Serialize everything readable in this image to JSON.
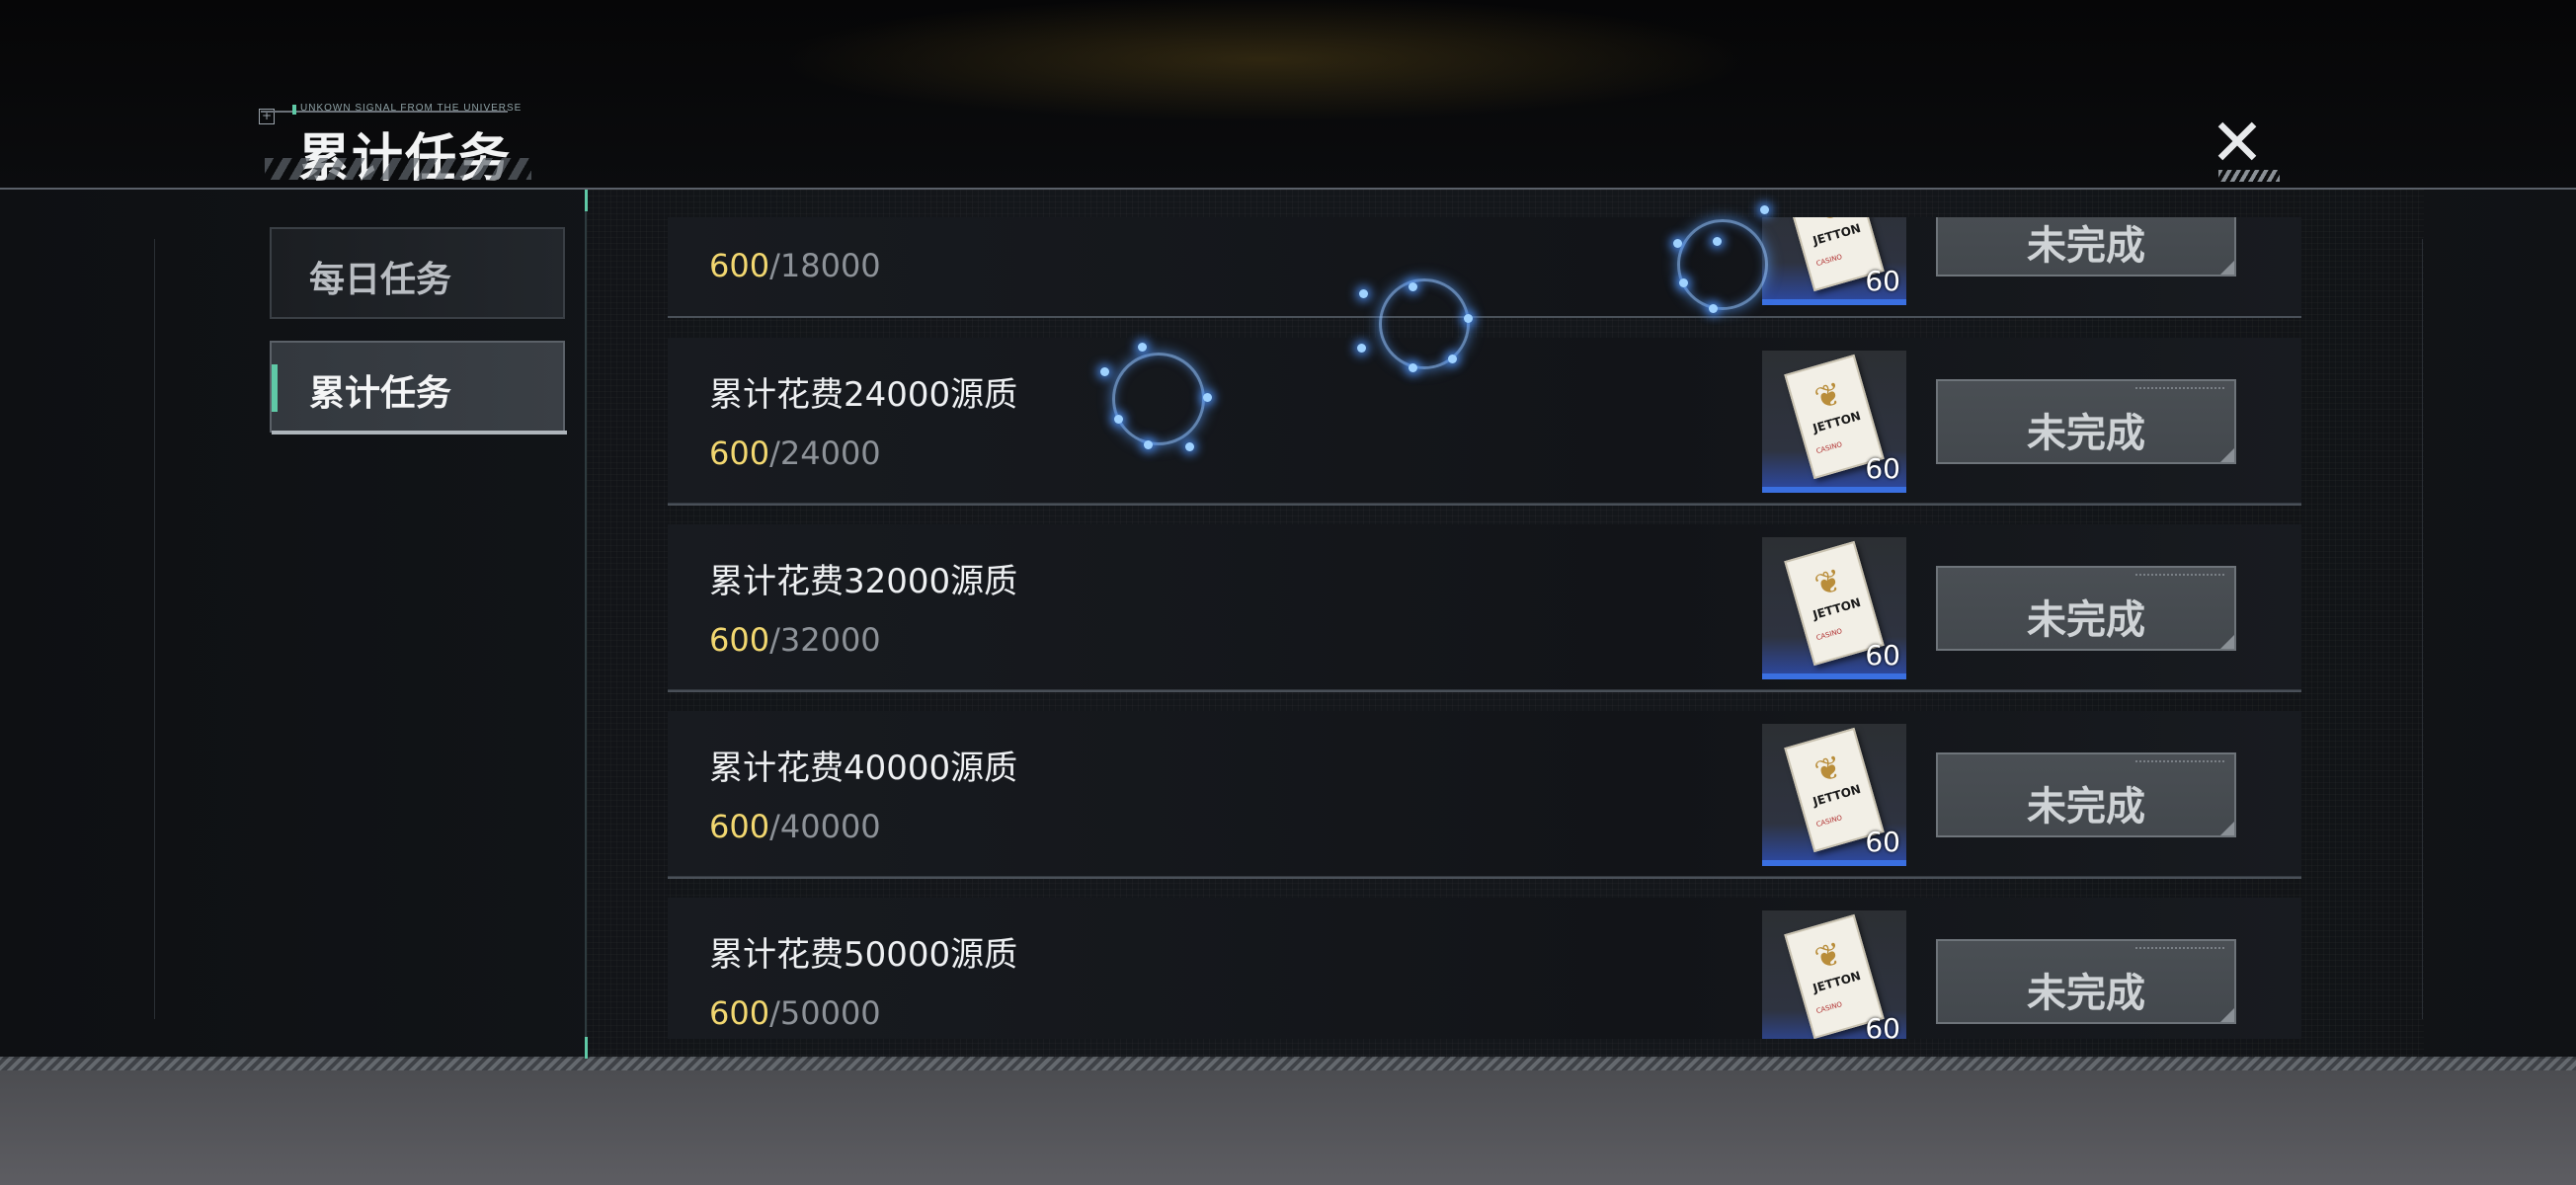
{
  "header": {
    "tagline": "UNKOWN SIGNAL FROM THE UNIVERSE",
    "title": "累计任务",
    "close_icon": "x-close-icon"
  },
  "tabs": [
    {
      "label": "每日任务",
      "active": false
    },
    {
      "label": "累计任务",
      "active": true
    }
  ],
  "tasks": [
    {
      "title": "",
      "current": "600",
      "target": "/18000",
      "reward_qty": "60",
      "status": "未完成"
    },
    {
      "title": "累计花费24000源质",
      "current": "600",
      "target": "/24000",
      "reward_qty": "60",
      "status": "未完成"
    },
    {
      "title": "累计花费32000源质",
      "current": "600",
      "target": "/32000",
      "reward_qty": "60",
      "status": "未完成"
    },
    {
      "title": "累计花费40000源质",
      "current": "600",
      "target": "/40000",
      "reward_qty": "60",
      "status": "未完成"
    },
    {
      "title": "累计花费50000源质",
      "current": "600",
      "target": "/50000",
      "reward_qty": "60",
      "status": "未完成"
    }
  ],
  "reward_item": {
    "icon": "jetton-card-icon",
    "card_text": "JETTON",
    "card_sub": "CASINO"
  },
  "colors": {
    "accent": "#5fc9a6",
    "progress_current": "#f2d770",
    "reward_rarity": "#3a6fe0"
  }
}
